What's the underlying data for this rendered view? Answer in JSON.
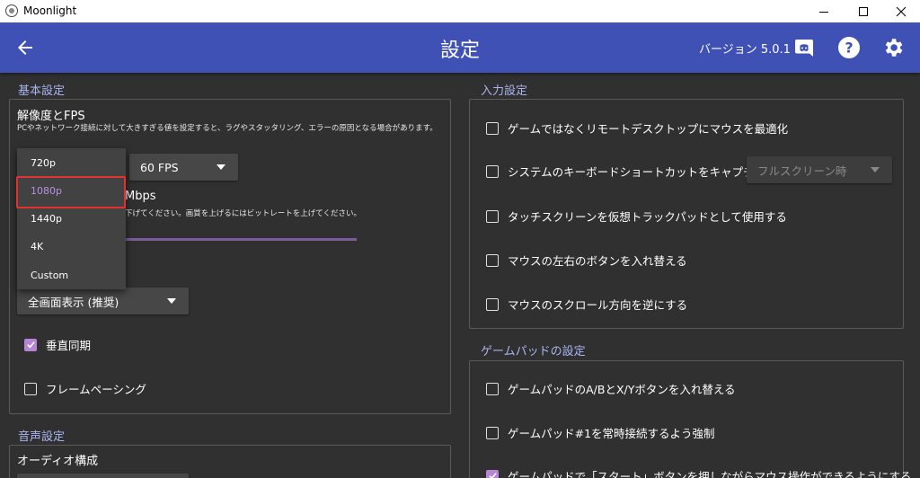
{
  "window": {
    "title": "Moonlight"
  },
  "toolbar": {
    "title": "設定",
    "version": "バージョン 5.0.1"
  },
  "basic": {
    "section_title": "基本設定",
    "resolution_title": "解像度とFPS",
    "resolution_hint": "PCやネットワーク接続に対して大きすぎる値を設定すると、ラグやスタッタリング、エラーの原因となる場合があります。",
    "fps_value": "60 FPS",
    "bitrate_unit_fragment": "Mbps",
    "bitrate_hint_fragment": "下げてください。画質を上げるにはビットレートを上げてください。",
    "display_mode_value": "全画面表示 (推奨)",
    "vsync_label": "垂直同期",
    "vsync_checked": true,
    "frame_pacing_label": "フレームペーシング",
    "frame_pacing_checked": false
  },
  "resolution_dropdown": {
    "options": [
      "720p",
      "1080p",
      "1440p",
      "4K",
      "Custom"
    ],
    "selected": "1080p"
  },
  "audio": {
    "section_title": "音声設定",
    "config_title": "オーディオ構成"
  },
  "input": {
    "section_title": "入力設定",
    "items": [
      {
        "label": "ゲームではなくリモートデスクトップにマウスを最適化",
        "checked": false
      },
      {
        "label": "システムのキーボードショートカットをキャプチャ",
        "checked": false
      },
      {
        "label": "タッチスクリーンを仮想トラックパッドとして使用する",
        "checked": false
      },
      {
        "label": "マウスの左右のボタンを入れ替える",
        "checked": false
      },
      {
        "label": "マウスのスクロール方向を逆にする",
        "checked": false
      }
    ],
    "capture_mode_value": "フルスクリーン時"
  },
  "gamepad": {
    "section_title": "ゲームパッドの設定",
    "items": [
      {
        "label": "ゲームパッドのA/BとX/Yボタンを入れ替える",
        "checked": false
      },
      {
        "label": "ゲームパッド#1を常時接続するよう強制",
        "checked": false
      },
      {
        "label": "ゲームパッドで「スタート」ボタンを押しながらマウス操作ができるようにする",
        "checked": true
      }
    ]
  },
  "colors": {
    "toolbar": "#3f51b5",
    "background": "#303030",
    "accent": "#b784d6",
    "section_title": "#aab4f0",
    "highlight": "#e0332f"
  }
}
